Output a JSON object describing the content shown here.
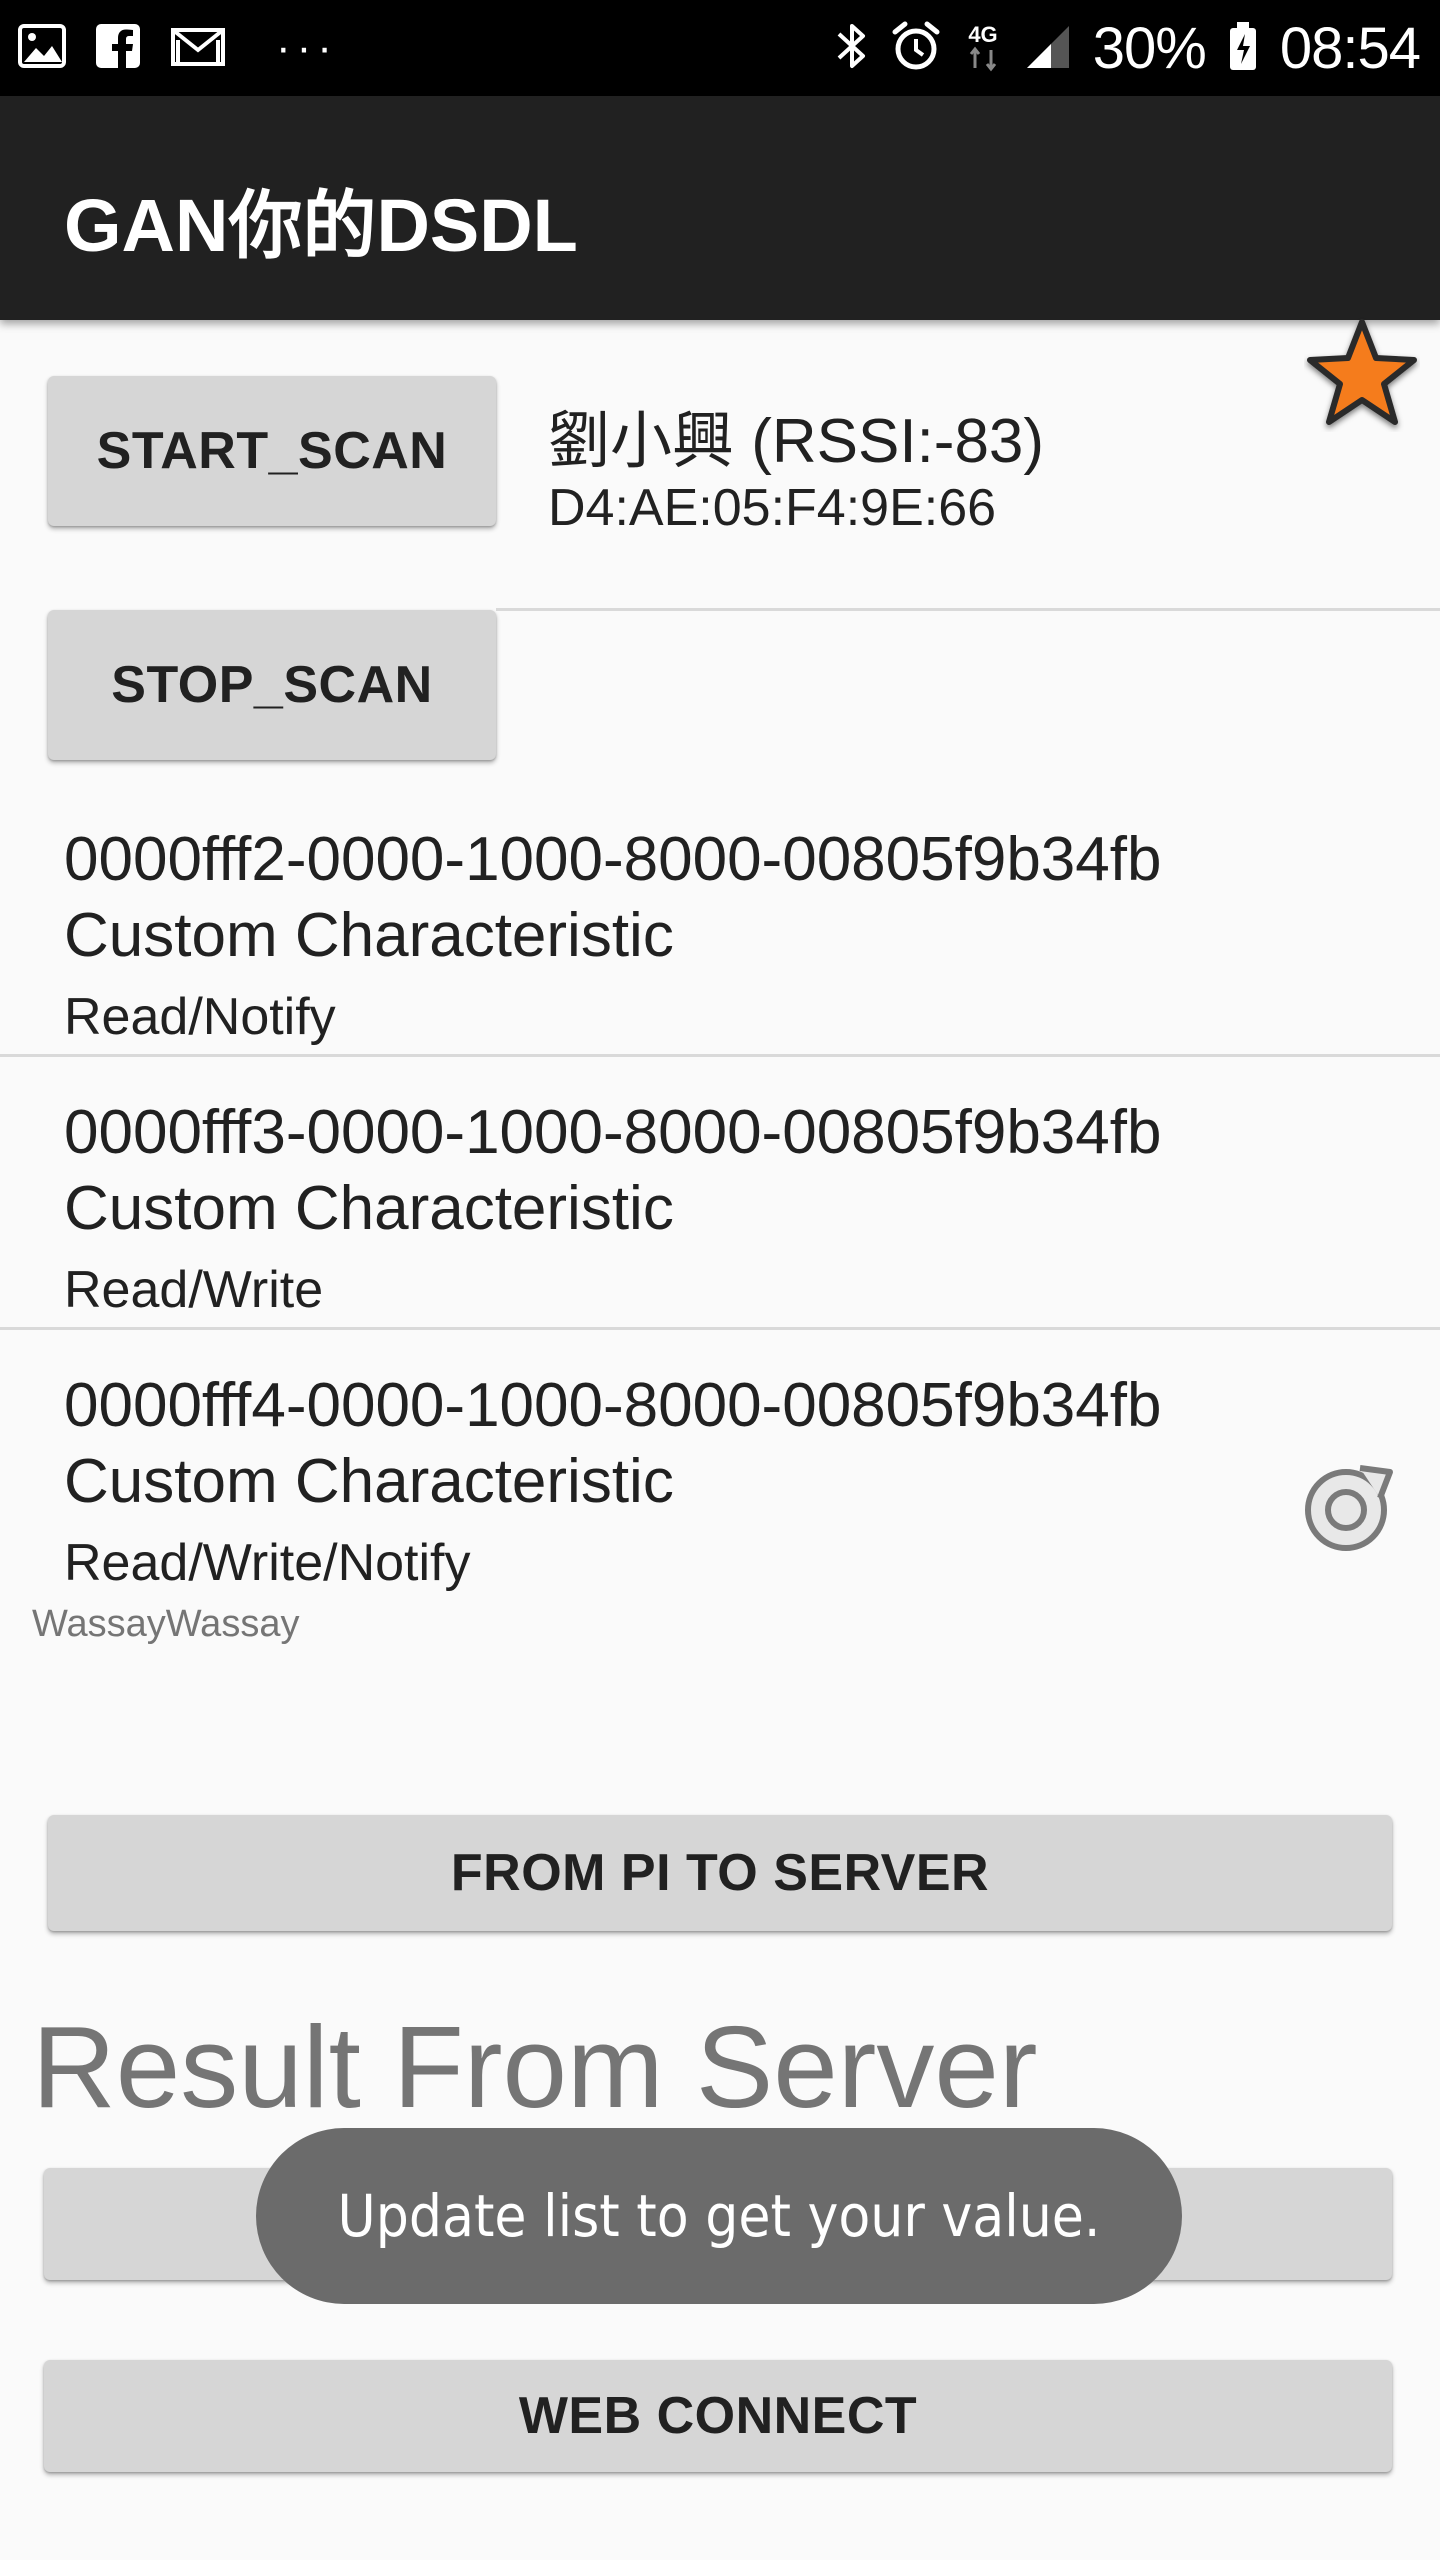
{
  "status_bar": {
    "icons": [
      "gallery-icon",
      "facebook-icon",
      "gmail-icon",
      "more-notifications-icon",
      "bluetooth-icon",
      "alarm-icon",
      "network-4g-icon",
      "signal-icon",
      "battery-icon"
    ],
    "network": "4G",
    "more": "···",
    "battery": "30%",
    "time": "08:54"
  },
  "app_bar": {
    "title": "GAN你的DSDL"
  },
  "scan": {
    "start_label": "START_SCAN",
    "stop_label": "STOP_SCAN",
    "device_name": "劉小興 (RSSI:-83)",
    "device_mac": "D4:AE:05:F4:9E:66",
    "favorite_icon": "star-icon"
  },
  "characteristics": [
    {
      "uuid": "0000fff2-0000-1000-8000-00805f9b34fb",
      "type": "Custom Characteristic",
      "props": "Read/Notify"
    },
    {
      "uuid": "0000fff3-0000-1000-8000-00805f9b34fb",
      "type": "Custom Characteristic",
      "props": "Read/Write"
    },
    {
      "uuid": "0000fff4-0000-1000-8000-00805f9b34fb",
      "type": "Custom Characteristic",
      "props": "Read/Write/Notify"
    }
  ],
  "refresh_icon": "refresh-icon",
  "value_label": "WassayWassay",
  "buttons": {
    "from_pi": "FROM PI TO SERVER",
    "web_connect": "WEB CONNECT"
  },
  "result_title": "Result From Server",
  "toast": "Update list to get your value.",
  "colors": {
    "status_bar": "#000000",
    "app_bar": "#212121",
    "background": "#fafafa",
    "button": "#d6d6d6",
    "toast": "#6b6b6b",
    "star": "#f57c1f"
  }
}
